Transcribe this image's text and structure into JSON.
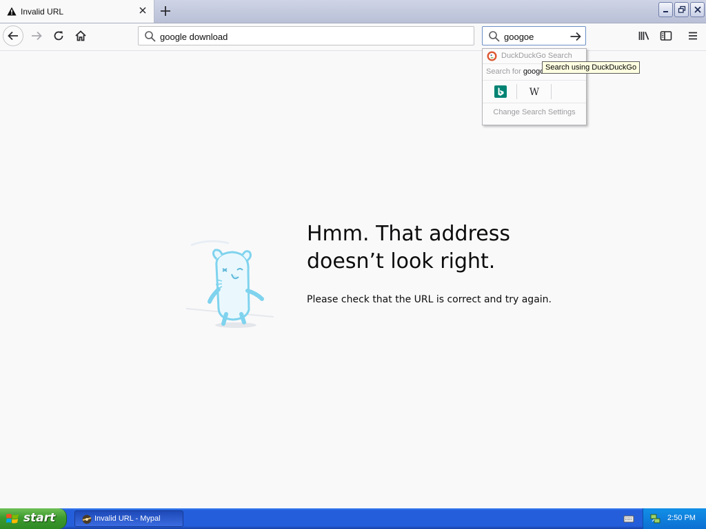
{
  "tab": {
    "title": "Invalid URL",
    "icon": "warning-icon"
  },
  "window_controls": [
    "minimize",
    "restore",
    "close"
  ],
  "navigation": {
    "url_value": "google download",
    "search_value": "googoe"
  },
  "search_dropdown": {
    "engine_header": "DuckDuckGo Search",
    "search_for_label": "Search for",
    "search_for_query": "googo",
    "engines": [
      "bing-icon",
      "wikipedia-icon"
    ],
    "change_settings": "Change Search Settings"
  },
  "tooltip": "Search using DuckDuckGo",
  "error_page": {
    "title_line1": "Hmm. That address",
    "title_line2": "doesn’t look right.",
    "description": "Please check that the URL is correct and try again."
  },
  "taskbar": {
    "start_label": "start",
    "task_label": "Invalid URL - Mypal",
    "clock": "2:50 PM"
  },
  "colors": {
    "page_bg": "#f9f9fa",
    "taskbar_blue": "#245edb",
    "start_green": "#3c9a2e",
    "mascot_cyan": "#7fd3ee"
  }
}
